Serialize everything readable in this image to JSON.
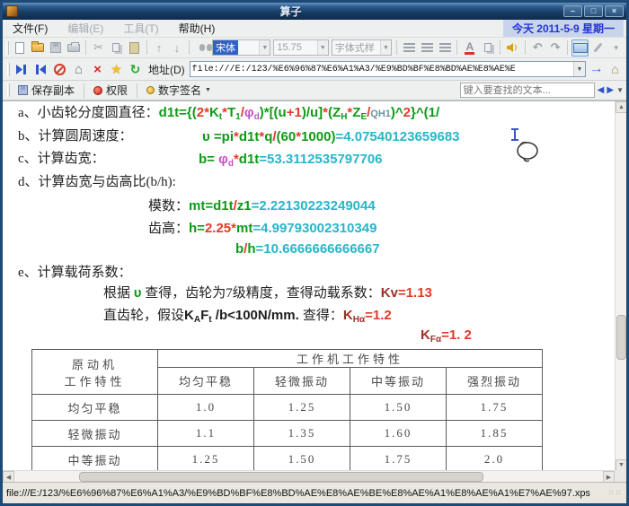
{
  "window": {
    "title": "算子",
    "minimize": "–",
    "maximize": "□",
    "close": "×"
  },
  "menu": {
    "file": "文件(F)",
    "edit": "编辑(E)",
    "tools": "工具(T)",
    "help": "帮助(H)",
    "date_display": "今天 2011-5-9 星期一"
  },
  "toolbar": {
    "font_name": "宋体",
    "font_size": "15.75",
    "font_style": "字体式样",
    "font_color_letter": "A"
  },
  "address_bar": {
    "label": "地址(D)",
    "value": "file:///E:/123/%E6%96%87%E6%A1%A3/%E9%BD%BF%E8%BD%AE%E8%AE%E"
  },
  "doc_toolbar": {
    "save_copy": "保存副本",
    "permissions": "权限",
    "signature": "数字签名",
    "search_placeholder": "键入要查找的文本..."
  },
  "icons": {
    "cut": "✂",
    "arrow_up": "↑",
    "arrow_down": "↓",
    "undo": "↶",
    "redo": "↷",
    "star": "★",
    "home": "⌂",
    "refresh": "↻",
    "go": "→",
    "close_x": "×",
    "dropdown": "▼",
    "overflow": "▾",
    "scroll_up": "▲",
    "scroll_down": "▼",
    "scroll_left": "◀",
    "scroll_right": "▶",
    "find_prev": "◀",
    "find_next": "▶",
    "find_drop": "▼",
    "sig_drop": "▼",
    "grip": "⁙⁙"
  },
  "colors": {
    "formula_green": "#0d9b17",
    "operator_red": "#e23a2b",
    "result_cyan": "#27b6c9",
    "phi_magenta": "#c44fc4",
    "factor_maroon": "#993326",
    "date_blue": "#2334cf"
  },
  "document": {
    "line_a": [
      {
        "t": "a、小齿轮分度圆直径：",
        "c": "ink",
        "f": "serif"
      },
      {
        "t": "d1t={(",
        "c": "green"
      },
      {
        "t": "2*",
        "c": "red"
      },
      {
        "t": "K",
        "c": "green"
      },
      {
        "t": "t",
        "c": "green",
        "sub": true
      },
      {
        "t": "*",
        "c": "red"
      },
      {
        "t": "T",
        "c": "green"
      },
      {
        "t": "1",
        "c": "green",
        "sub": true
      },
      {
        "t": "/",
        "c": "red"
      },
      {
        "t": "φ",
        "c": "magenta"
      },
      {
        "t": "d",
        "c": "magenta",
        "sub": true
      },
      {
        "t": ")*[(u",
        "c": "green"
      },
      {
        "t": "+1",
        "c": "red"
      },
      {
        "t": ")/u]",
        "c": "green"
      },
      {
        "t": "*",
        "c": "red"
      },
      {
        "t": "(Z",
        "c": "green"
      },
      {
        "t": "H",
        "c": "green",
        "sub": true
      },
      {
        "t": "*",
        "c": "red"
      },
      {
        "t": "Z",
        "c": "green"
      },
      {
        "t": "E",
        "c": "green",
        "sub": true
      },
      {
        "t": "/",
        "c": "red"
      },
      {
        "t": "QH1",
        "c": "slate",
        "small": true
      },
      {
        "t": ")^",
        "c": "green"
      },
      {
        "t": "2",
        "c": "red"
      },
      {
        "t": "}^(1/",
        "c": "green"
      }
    ],
    "line_b_label": "b、计算圆周速度：",
    "line_b_formula": [
      {
        "t": "υ =",
        "c": "green"
      },
      {
        "t": "pi",
        "c": "green"
      },
      {
        "t": "*",
        "c": "red"
      },
      {
        "t": "d1t",
        "c": "green"
      },
      {
        "t": "*",
        "c": "red"
      },
      {
        "t": "q",
        "c": "green"
      },
      {
        "t": "/",
        "c": "red"
      },
      {
        "t": "(60",
        "c": "green"
      },
      {
        "t": "*",
        "c": "red"
      },
      {
        "t": "1000)",
        "c": "green"
      },
      {
        "t": "=4.07540123659683",
        "c": "cyan"
      }
    ],
    "line_c_label": "c、计算齿宽：",
    "line_c_formula": [
      {
        "t": "b= ",
        "c": "green"
      },
      {
        "t": "φ",
        "c": "magenta"
      },
      {
        "t": "d",
        "c": "magenta",
        "sub": true
      },
      {
        "t": "*",
        "c": "red"
      },
      {
        "t": "d1t",
        "c": "green"
      },
      {
        "t": "=53.3112535797706",
        "c": "cyan"
      }
    ],
    "line_d": "d、计算齿宽与齿高比(b/h):",
    "line_mod_label": "模数：",
    "line_mod_formula": [
      {
        "t": "mt=d1t",
        "c": "green"
      },
      {
        "t": "/",
        "c": "red"
      },
      {
        "t": "z1",
        "c": "green"
      },
      {
        "t": "=2.22130223249044",
        "c": "cyan"
      }
    ],
    "line_h_label": "齿高：",
    "line_h_formula": [
      {
        "t": "h=",
        "c": "green"
      },
      {
        "t": "2.25",
        "c": "red"
      },
      {
        "t": "*",
        "c": "red"
      },
      {
        "t": "mt",
        "c": "green"
      },
      {
        "t": "=4.99793002310349",
        "c": "cyan"
      }
    ],
    "line_bh_formula": [
      {
        "t": "b",
        "c": "green"
      },
      {
        "t": "/",
        "c": "red"
      },
      {
        "t": "h",
        "c": "green"
      },
      {
        "t": "=10.6666666666667",
        "c": "cyan"
      }
    ],
    "line_e": "e、计算载荷系数：",
    "line_kv": [
      {
        "t": "根据 ",
        "c": "ink",
        "f": "serif"
      },
      {
        "t": "υ",
        "c": "green"
      },
      {
        "t": " 查得，齿轮为7级精度，查得动载系数：",
        "c": "ink",
        "f": "serif"
      },
      {
        "t": "Kv",
        "c": "maroon"
      },
      {
        "t": "=1.13",
        "c": "red"
      }
    ],
    "line_kh": [
      {
        "t": "直齿轮，假设",
        "c": "ink",
        "f": "serif"
      },
      {
        "t": "K",
        "c": "ink"
      },
      {
        "t": "A",
        "c": "ink",
        "sub": true
      },
      {
        "t": "F",
        "c": "ink"
      },
      {
        "t": "t",
        "c": "ink",
        "sub": true
      },
      {
        "t": " /b<100N/mm. ",
        "c": "ink"
      },
      {
        "t": "查得：",
        "c": "ink",
        "f": "serif"
      },
      {
        "t": "K",
        "c": "maroon"
      },
      {
        "t": "Hα",
        "c": "maroon",
        "sub": true
      },
      {
        "t": "=1.2",
        "c": "red"
      }
    ],
    "line_kf": [
      {
        "t": "K",
        "c": "maroon"
      },
      {
        "t": "Fα",
        "c": "maroon",
        "sub": true
      },
      {
        "t": "=1. 2",
        "c": "red"
      }
    ]
  },
  "table": {
    "corner_line1": "原动机",
    "corner_line2": "工作特性",
    "group_header": "工作机工作特性",
    "col_headers": [
      "均匀平稳",
      "轻微振动",
      "中等振动",
      "强烈振动"
    ],
    "rows": [
      {
        "label": "均匀平稳",
        "values": [
          "1.0",
          "1.25",
          "1.50",
          "1.75"
        ]
      },
      {
        "label": "轻微振动",
        "values": [
          "1.1",
          "1.35",
          "1.60",
          "1.85"
        ]
      },
      {
        "label": "中等振动",
        "values": [
          "1.25",
          "1.50",
          "1.75",
          "2.0"
        ]
      }
    ]
  },
  "status_bar": {
    "path": "file:///E:/123/%E6%96%87%E6%A1%A3/%E9%BD%BF%E8%BD%AE%E8%AE%BE%E8%AE%A1%E8%AE%A1%E7%AE%97.xps"
  }
}
